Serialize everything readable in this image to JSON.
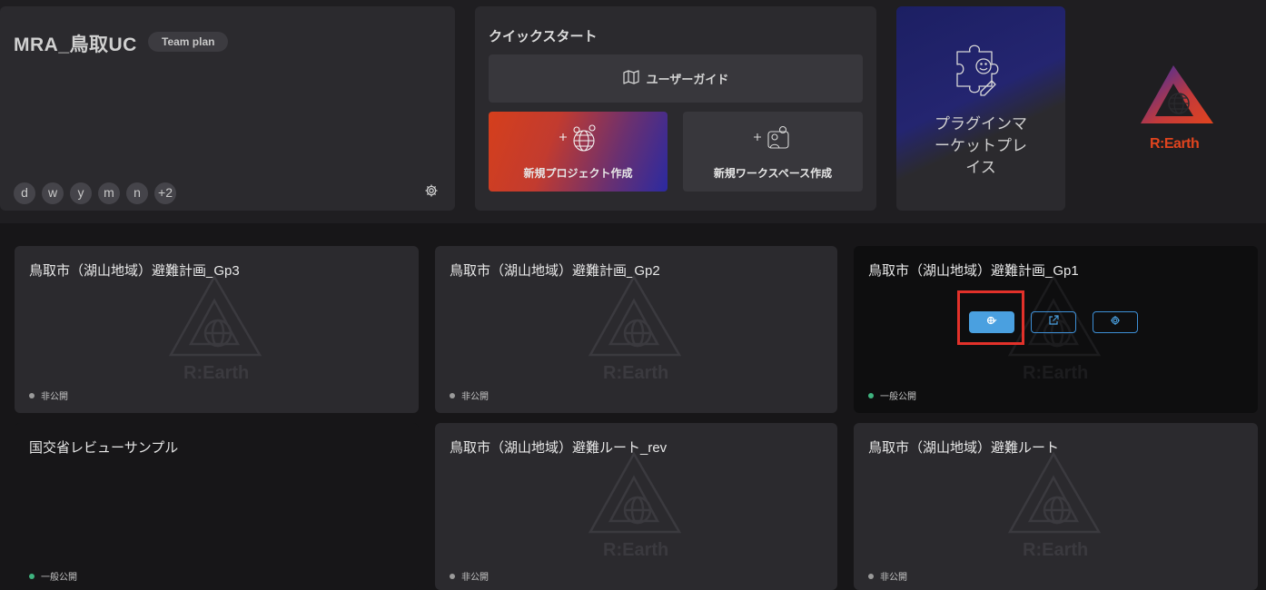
{
  "workspace": {
    "name": "MRA_鳥取UC",
    "plan": "Team plan",
    "members": [
      "d",
      "w",
      "y",
      "m",
      "n",
      "+2"
    ]
  },
  "quickstart": {
    "title": "クイックスタート",
    "user_guide": "ユーザーガイド",
    "new_project": "新規プロジェクト作成",
    "new_workspace": "新規ワークスペース作成"
  },
  "plugin_market": {
    "lines": [
      "プラグインマ",
      "ーケットプレ",
      "イス"
    ]
  },
  "brand": {
    "logo_text": "R:Earth",
    "watermark_text": "R:Earth",
    "accent": "#e0441e"
  },
  "projects": [
    {
      "title": "鳥取市（湖山地域）避難計画_Gp3",
      "status": "非公開",
      "status_color": "#9a9a9a"
    },
    {
      "title": "鳥取市（湖山地域）避難計画_Gp2",
      "status": "非公開",
      "status_color": "#9a9a9a"
    },
    {
      "title": "鳥取市（湖山地域）避難計画_Gp1",
      "status": "一般公開",
      "status_color": "#3fb37f",
      "hovered": true
    },
    {
      "title": "国交省レビューサンプル",
      "status": "一般公開",
      "status_color": "#3fb37f"
    },
    {
      "title": "鳥取市（湖山地域）避難ルート_rev",
      "status": "非公開",
      "status_color": "#9a9a9a"
    },
    {
      "title": "鳥取市（湖山地域）避難ルート",
      "status": "非公開",
      "status_color": "#9a9a9a"
    }
  ],
  "project_actions": {
    "icons": [
      "editor-icon",
      "open-external-icon",
      "settings-icon"
    ],
    "primary_color": "#4aa0e0"
  }
}
